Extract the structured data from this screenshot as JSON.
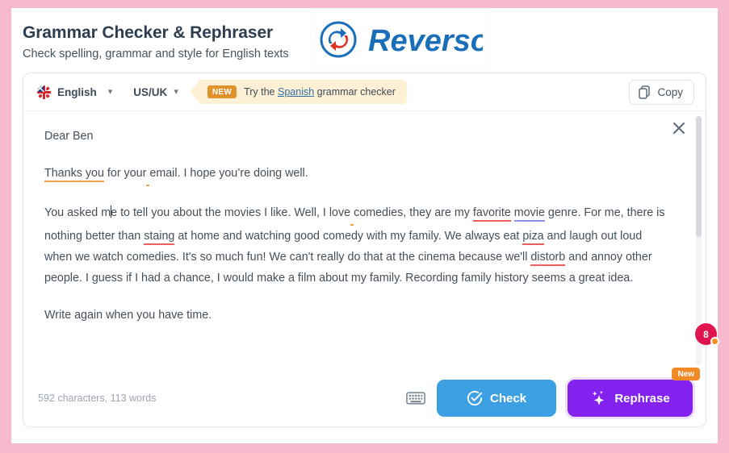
{
  "header": {
    "title": "Grammar Checker & Rephraser",
    "subtitle": "Check spelling, grammar and style for English texts",
    "brand": "Reverso"
  },
  "toolbar": {
    "language": "English",
    "variant": "US/UK",
    "promo_badge": "NEW",
    "promo_prefix": "Try the ",
    "promo_link": "Spanish",
    "promo_suffix": " grammar checker",
    "copy_label": "Copy"
  },
  "document": {
    "greeting": "Dear Ben",
    "line2_a": "Thanks you",
    "line2_b": " for your",
    "line2_c": "email. I hope you’re doing well.",
    "body_1": "You asked m",
    "body_2": "e to tell you about the movies I like. Well, I love",
    "body_3": "comedies, they are my ",
    "body_err_favorite": "favorite",
    "body_4": " ",
    "body_err_movie": "movie",
    "body_5": " genre. For me, there is nothing better than ",
    "body_err_staing": "staing",
    "body_6": " at home and watching good comedy with my family. We always eat ",
    "body_err_piza": "piza",
    "body_7": " and laugh out loud when we watch comedies. It's so much fun! We can't really do that at the cinema because we'll ",
    "body_err_distorb": "distorb",
    "body_8": " and annoy other people. I guess if I had a chance, I would make a film about my family. Recording family history seems a great idea.",
    "closing": "Write again when you have time."
  },
  "footer": {
    "counter": "592 characters,  113 words",
    "check_label": "Check",
    "rephrase_label": "Rephrase",
    "rephrase_ribbon": "New"
  },
  "help": {
    "count": "8"
  },
  "colors": {
    "page_bg": "#f6b9cd",
    "accent_check": "#3da0e3",
    "accent_rephrase": "#8322ef",
    "promo_bg": "#fdf0d4",
    "badge_orange": "#e2922c",
    "error_red": "#ef5f5f",
    "error_orange": "#f0a24b",
    "error_purple": "#8b8bf0",
    "help_red": "#e0154f",
    "brand_blue": "#1b6fb8"
  }
}
